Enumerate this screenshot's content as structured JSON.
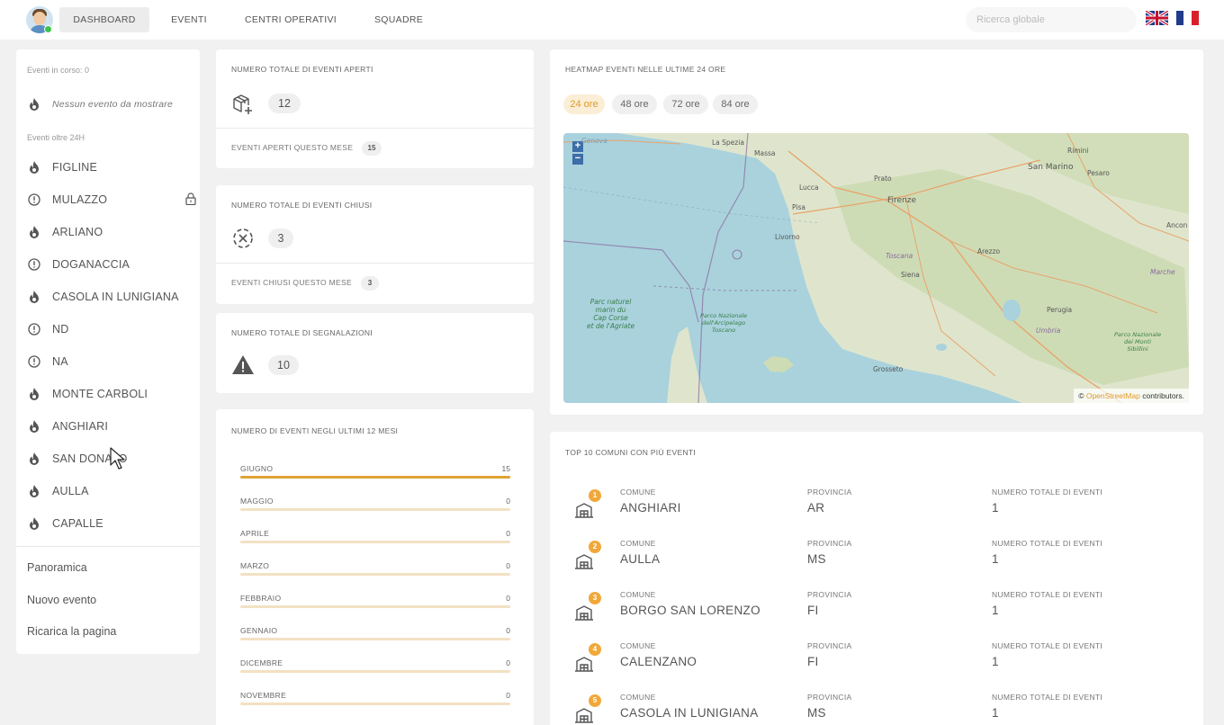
{
  "nav": {
    "items": [
      {
        "label": "DASHBOARD",
        "active": true
      },
      {
        "label": "EVENTI",
        "active": false
      },
      {
        "label": "CENTRI OPERATIVI",
        "active": false
      },
      {
        "label": "SQUADRE",
        "active": false
      }
    ],
    "search_placeholder": "Ricerca globale",
    "flags": [
      "flag-uk-icon",
      "flag-fr-icon"
    ]
  },
  "sidebar": {
    "events_in_progress": "Eventi in corso: 0",
    "no_events": "Nessun evento da mostrare",
    "events_over_24h": "Eventi oltre 24H",
    "items": [
      {
        "label": "FIGLINE",
        "icon": "fire-icon"
      },
      {
        "label": "MULAZZO",
        "icon": "alert-circle-icon",
        "locked": true
      },
      {
        "label": "ARLIANO",
        "icon": "fire-icon"
      },
      {
        "label": "DOGANACCIA",
        "icon": "alert-circle-icon"
      },
      {
        "label": "CASOLA IN LUNIGIANA",
        "icon": "fire-icon"
      },
      {
        "label": "ND",
        "icon": "alert-circle-icon"
      },
      {
        "label": "NA",
        "icon": "alert-circle-icon"
      },
      {
        "label": "MONTE CARBOLI",
        "icon": "fire-icon"
      },
      {
        "label": "ANGHIARI",
        "icon": "fire-icon"
      },
      {
        "label": "SAN DONATO",
        "icon": "fire-icon"
      },
      {
        "label": "AULLA",
        "icon": "fire-icon"
      },
      {
        "label": "CAPALLE",
        "icon": "fire-icon"
      }
    ],
    "links": [
      "Panoramica",
      "Nuovo evento",
      "Ricarica la pagina"
    ]
  },
  "stats": {
    "open": {
      "title": "NUMERO TOTALE DI EVENTI APERTI",
      "value": "12",
      "month_label": "EVENTI APERTI QUESTO MESE",
      "month_value": "15"
    },
    "closed": {
      "title": "NUMERO TOTALE DI EVENTI CHIUSI",
      "value": "3",
      "month_label": "EVENTI CHIUSI QUESTO MESE",
      "month_value": "3"
    },
    "reports": {
      "title": "NUMERO TOTALE DI SEGNALAZIONI",
      "value": "10"
    }
  },
  "months_card": {
    "title": "NUMERO DI EVENTI NEGLI ULTIMI 12 MESI",
    "rows": [
      {
        "month": "GIUGNO",
        "value": "15",
        "fill": 1.0
      },
      {
        "month": "MAGGIO",
        "value": "0",
        "fill": 0
      },
      {
        "month": "APRILE",
        "value": "0",
        "fill": 0
      },
      {
        "month": "MARZO",
        "value": "0",
        "fill": 0
      },
      {
        "month": "FEBBRAIO",
        "value": "0",
        "fill": 0
      },
      {
        "month": "GENNAIO",
        "value": "0",
        "fill": 0
      },
      {
        "month": "DICEMBRE",
        "value": "0",
        "fill": 0
      },
      {
        "month": "NOVEMBRE",
        "value": "0",
        "fill": 0
      }
    ]
  },
  "heatmap": {
    "title": "HEATMAP EVENTI NELLE ULTIME 24 ORE",
    "ranges": [
      {
        "label": "24 ore",
        "active": true
      },
      {
        "label": "48 ore",
        "active": false
      },
      {
        "label": "72 ore",
        "active": false
      },
      {
        "label": "84 ore",
        "active": false
      }
    ],
    "zoom_in": "+",
    "zoom_out": "−",
    "attribution_prefix": "©",
    "attribution_link": "OpenStreetMap",
    "attribution_suffix": "contributors.",
    "places": {
      "genova": "Genova",
      "la_spezia": "La Spezia",
      "massa": "Massa",
      "lucca": "Lucca",
      "prato": "Prato",
      "firenze": "Firenze",
      "pisa": "Pisa",
      "livorno": "Livorno",
      "toscana": "Toscana",
      "arezzo": "Arezzo",
      "siena": "Siena",
      "perugia": "Perugia",
      "umbria": "Umbria",
      "grosseto": "Grosseto",
      "rimini": "Rimini",
      "san_marino": "San Marino",
      "pesaro": "Pesaro",
      "ancona": "Ancon",
      "marche": "Marche",
      "corse_1": "Parc naturel",
      "corse_2": "marin du",
      "corse_3": "Cap Corse",
      "corse_4": "et de l'Agriate",
      "arcip_1": "Parco Nazionale",
      "arcip_2": "dell'Arcipelago",
      "arcip_3": "Toscano",
      "sibill_1": "Parco Nazionale",
      "sibill_2": "dei Monti",
      "sibill_3": "Sibillini"
    }
  },
  "top10": {
    "title": "TOP 10 COMUNI CON PIÙ EVENTI",
    "col_comune": "COMUNE",
    "col_provincia": "PROVINCIA",
    "col_totale": "NUMERO TOTALE DI EVENTI",
    "rows": [
      {
        "rank": "1",
        "comune": "ANGHIARI",
        "provincia": "AR",
        "totale": "1"
      },
      {
        "rank": "2",
        "comune": "AULLA",
        "provincia": "MS",
        "totale": "1"
      },
      {
        "rank": "3",
        "comune": "BORGO SAN LORENZO",
        "provincia": "FI",
        "totale": "1"
      },
      {
        "rank": "4",
        "comune": "CALENZANO",
        "provincia": "FI",
        "totale": "1"
      },
      {
        "rank": "5",
        "comune": "CASOLA IN LUNIGIANA",
        "provincia": "MS",
        "totale": "1"
      }
    ]
  },
  "colors": {
    "accent": "#e0a232",
    "accent_light": "#f2e1c3",
    "badge": "#f1a83a",
    "map_sea": "#a9d2dd",
    "map_land": "#dfe5cd"
  }
}
